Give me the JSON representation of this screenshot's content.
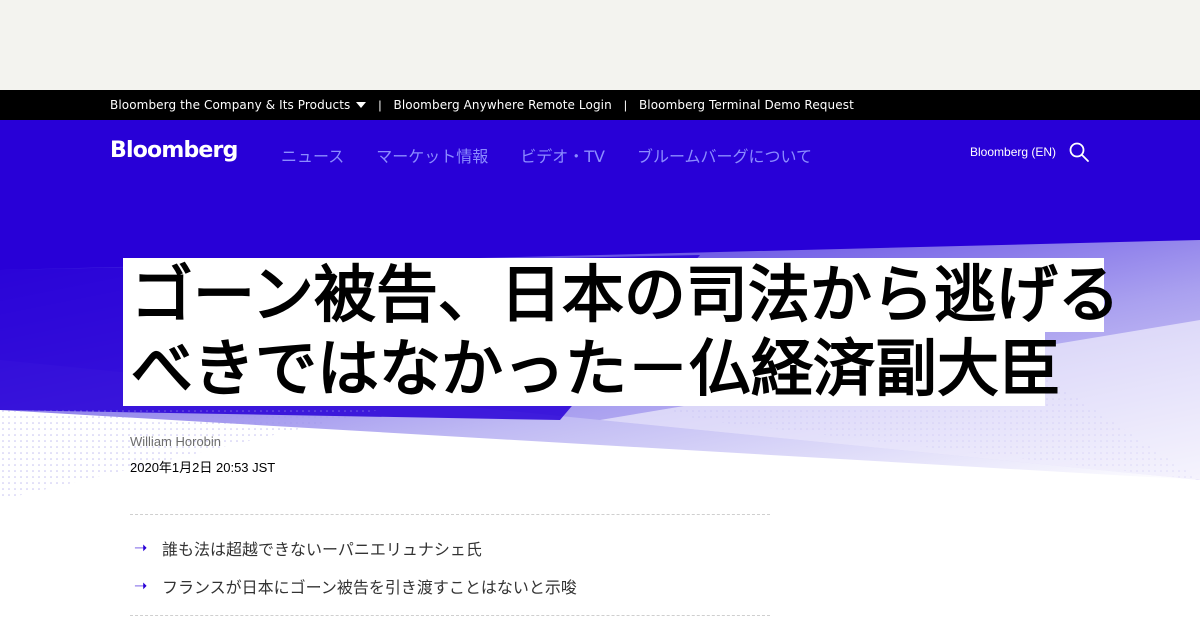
{
  "topbar": {
    "items": [
      "Bloomberg the Company & Its Products",
      "Bloomberg Anywhere Remote Login",
      "Bloomberg Terminal Demo Request"
    ]
  },
  "nav": {
    "logo": "Bloomberg",
    "links": [
      "ニュース",
      "マーケット情報",
      "ビデオ・TV",
      "ブルームバーグについて"
    ],
    "region": "Bloomberg (EN)"
  },
  "article": {
    "headline_line1": "ゴーン被告、日本の司法から逃げる",
    "headline_line2": "べきではなかった－仏経済副大臣",
    "author": "William Horobin",
    "datetime": "2020年1月2日 20:53 JST",
    "bullets": [
      "誰も法は超越できないーパニエリュナシェ氏",
      "フランスが日本にゴーン被告を引き渡すことはないと示唆"
    ]
  },
  "colors": {
    "brand_blue": "#2800d7",
    "nav_link": "#8c8cff",
    "topbar_bg": "#000000"
  },
  "icons": {
    "search": "search-icon",
    "caret": "chevron-down-icon",
    "arrow": "arrow-right-icon"
  }
}
